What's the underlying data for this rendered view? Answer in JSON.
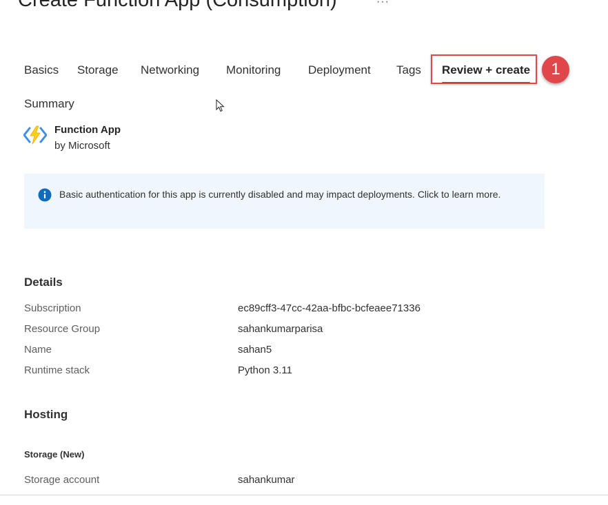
{
  "header": {
    "title": "Create Function App (Consumption)",
    "more_label": "···"
  },
  "tabs": [
    {
      "label": "Basics",
      "active": false
    },
    {
      "label": "Storage",
      "active": false
    },
    {
      "label": "Networking",
      "active": false
    },
    {
      "label": "Monitoring",
      "active": false
    },
    {
      "label": "Deployment",
      "active": false
    },
    {
      "label": "Tags",
      "active": false
    },
    {
      "label": "Review + create",
      "active": true
    }
  ],
  "annotation": {
    "step_number": "1",
    "color": "#e0474a"
  },
  "summary": {
    "label": "Summary",
    "app_name": "Function App",
    "publisher": "by Microsoft",
    "icon": "function-app-icon"
  },
  "info_banner": {
    "icon": "info-icon",
    "text": "Basic authentication for this app is currently disabled and may impact deployments. Click to learn more."
  },
  "details": {
    "heading": "Details",
    "rows": [
      {
        "label": "Subscription",
        "value": "ec89cff3-47cc-42aa-bfbc-bcfeaee71336"
      },
      {
        "label": "Resource Group",
        "value": "sahankumarparisa"
      },
      {
        "label": "Name",
        "value": "sahan5"
      },
      {
        "label": "Runtime stack",
        "value": "Python 3.11"
      }
    ]
  },
  "hosting": {
    "heading": "Hosting",
    "subheading": "Storage (New)",
    "rows": [
      {
        "label": "Storage account",
        "value": "sahankumar"
      }
    ]
  },
  "colors": {
    "accent": "#0f6cbd",
    "highlight_border": "#e04848",
    "banner_bg": "#eff6fc",
    "info_icon": "#0f6cbd"
  }
}
